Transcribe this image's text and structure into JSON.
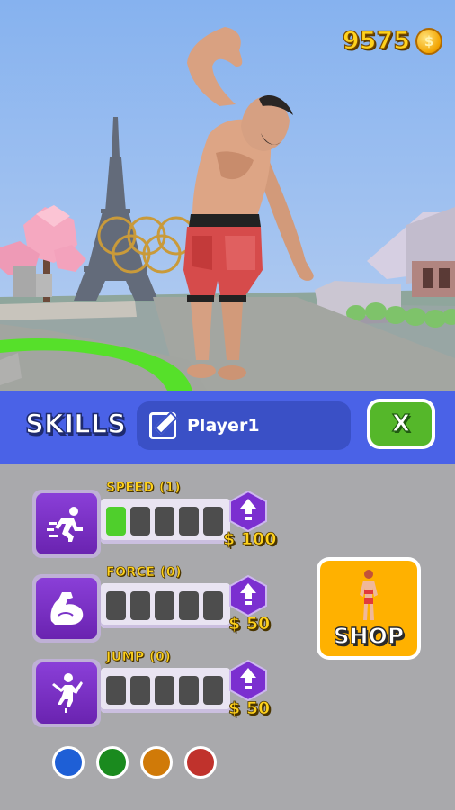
{
  "hud": {
    "coin_count": "9575",
    "coin_icon": "coin-icon"
  },
  "skills_panel": {
    "title": "SKILLS",
    "player_name": "Player1",
    "edit_icon": "edit-pencil-icon",
    "close_label": "X",
    "skills": [
      {
        "label": "SPEED (1)",
        "level": 1,
        "max_level": 5,
        "price": "$ 100",
        "icon": "running-icon"
      },
      {
        "label": "FORCE (0)",
        "level": 0,
        "max_level": 5,
        "price": "$ 50",
        "icon": "flexed-arm-icon"
      },
      {
        "label": "JUMP (0)",
        "level": 0,
        "max_level": 5,
        "price": "$ 50",
        "icon": "jumping-icon"
      }
    ],
    "shop_label": "SHOP",
    "skin_colors": [
      "#1e5fd6",
      "#1a8a1e",
      "#d07a08",
      "#c0322c"
    ]
  },
  "colors": {
    "header_blue": "#4a62e7",
    "panel_gray": "#a9a9ac",
    "upgrade_purple": "#7b2fd0",
    "level_on": "#4fcf2c",
    "level_off": "#4d4d4d",
    "shop_orange": "#ffb100",
    "close_green": "#55b72a"
  }
}
